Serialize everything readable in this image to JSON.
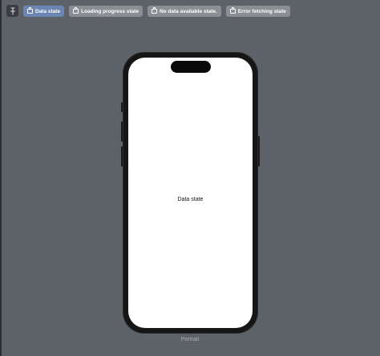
{
  "toolbar": {
    "pin_icon": "pin-icon",
    "chips": [
      {
        "label": "Data state",
        "active": true
      },
      {
        "label": "Loading progress state",
        "active": false
      },
      {
        "label": "No data available state.",
        "active": false
      },
      {
        "label": "Error fetching state",
        "active": false
      }
    ]
  },
  "preview": {
    "screen_text": "Data state",
    "orientation_label": "Portrait"
  },
  "colors": {
    "background": "#5d6168",
    "active_chip": "#6c86b3",
    "inactive_chip": "#8b8e93",
    "device_frame": "#161616",
    "screen": "#ffffff"
  }
}
